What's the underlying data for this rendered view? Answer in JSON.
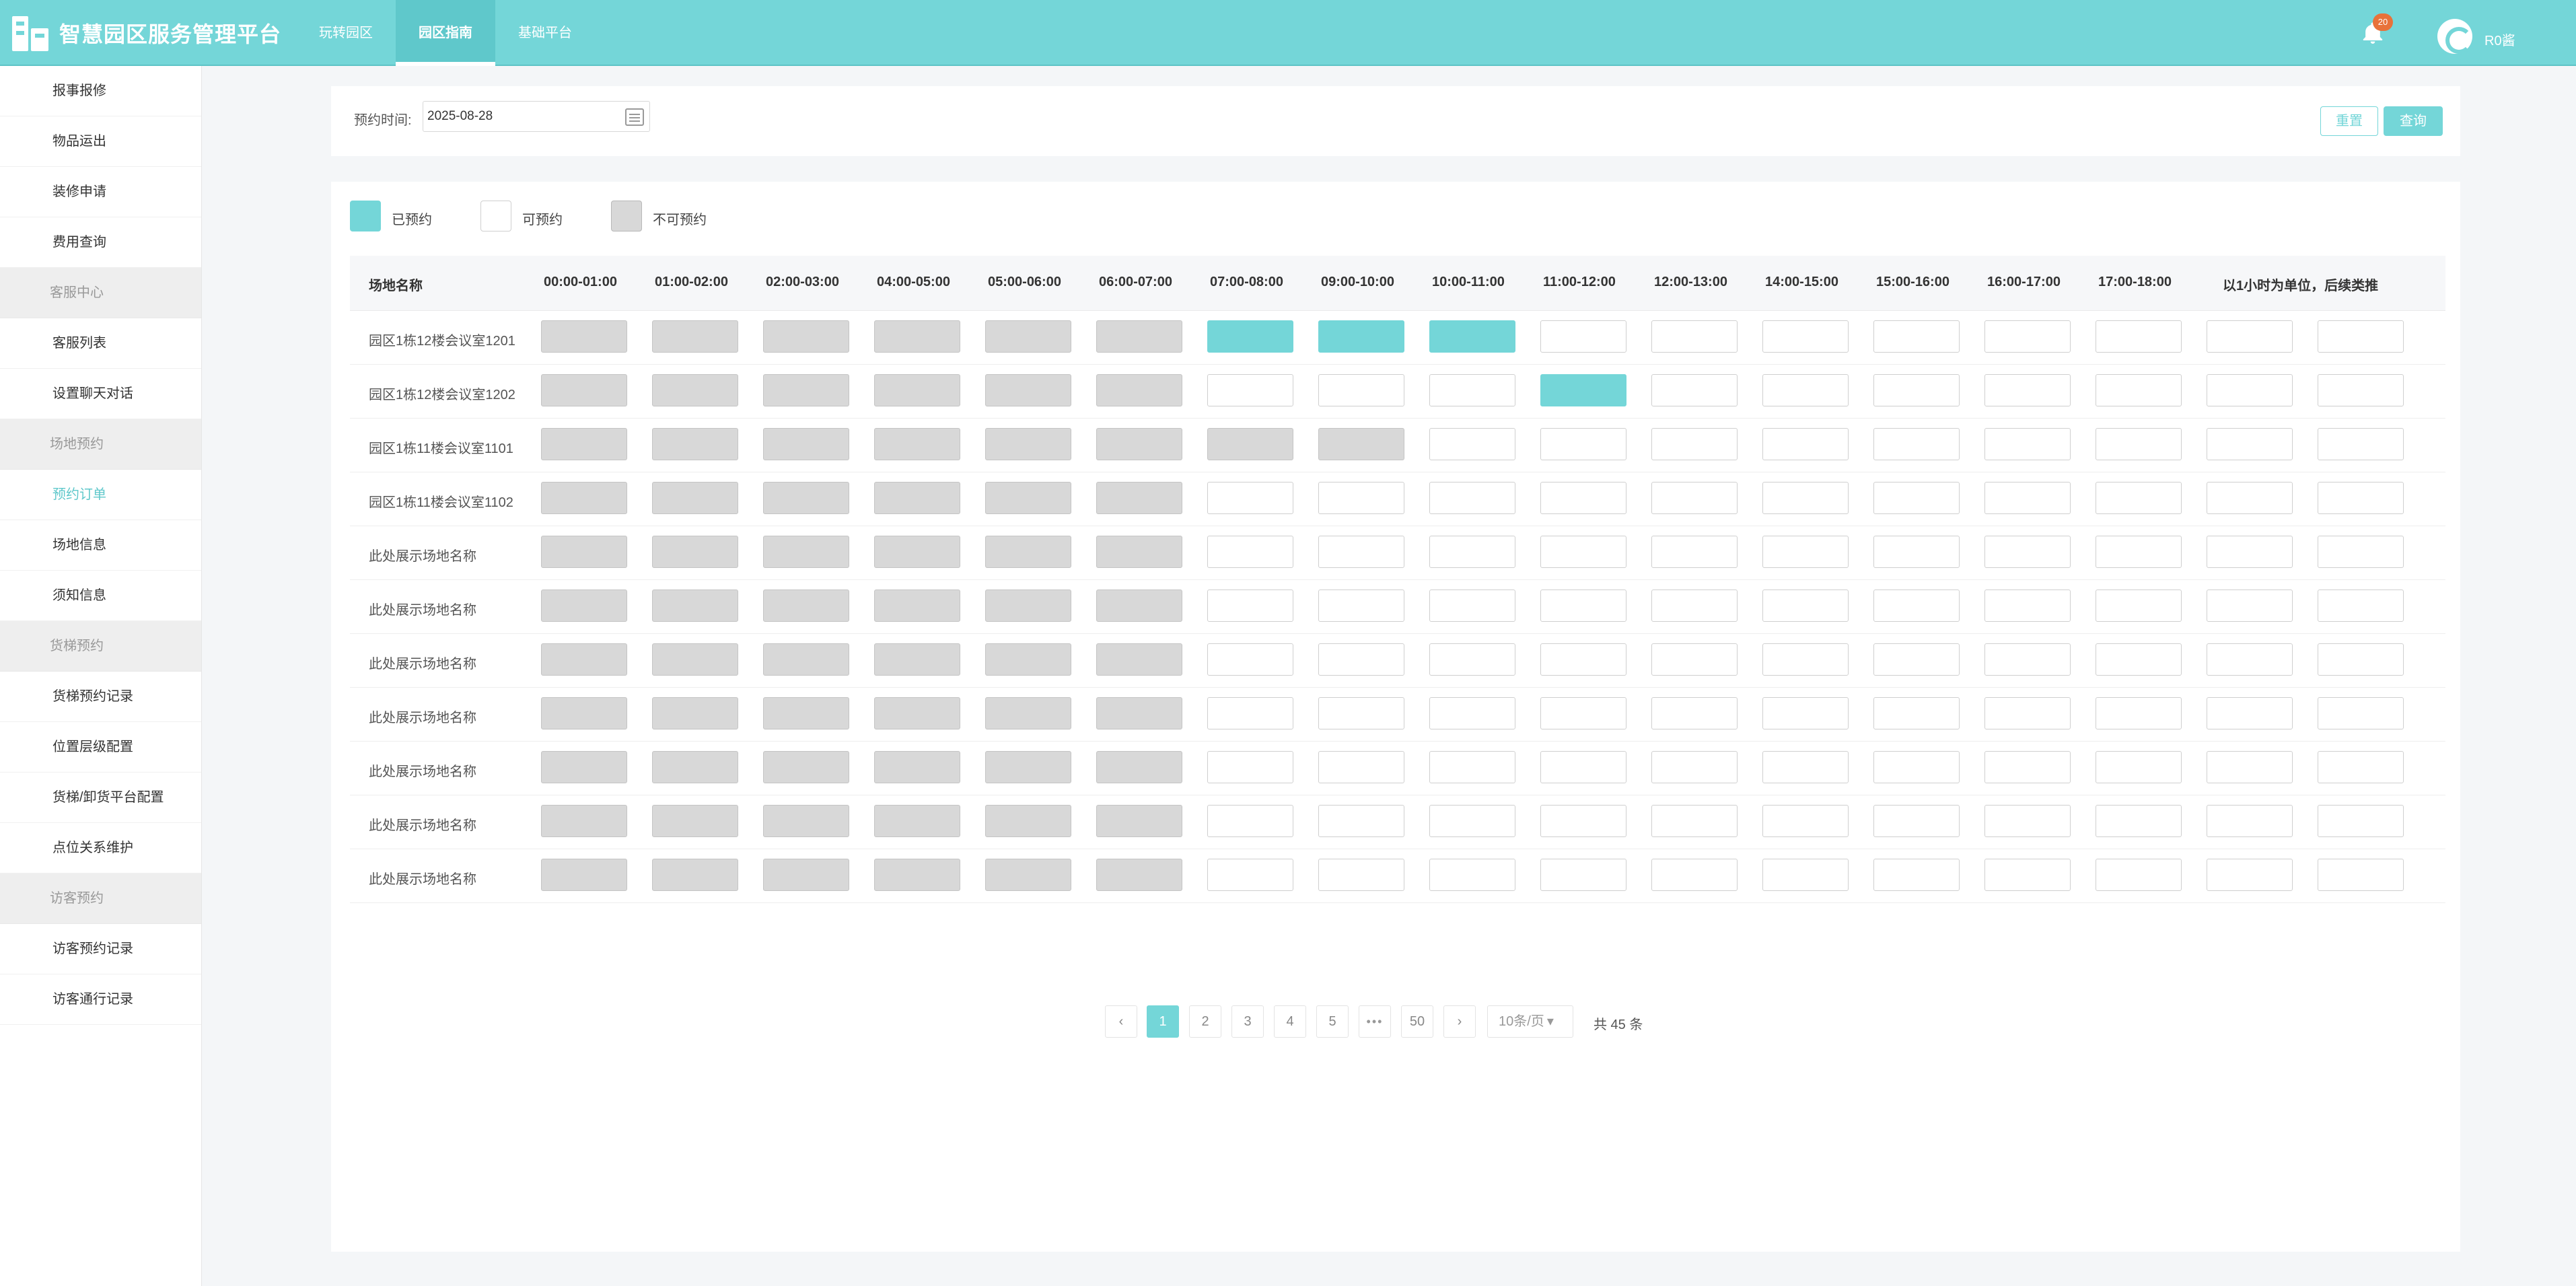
{
  "header": {
    "app_title": "智慧园区服务管理平台",
    "tabs": [
      {
        "label": "玩转园区",
        "active": false
      },
      {
        "label": "园区指南",
        "active": true
      },
      {
        "label": "基础平台",
        "active": false
      }
    ],
    "notification_count": "20",
    "username": "R0酱",
    "icons": {
      "logo": "building-logo-icon",
      "bell": "bell-icon",
      "avatar": "user-avatar-icon"
    }
  },
  "sidebar": {
    "items": [
      {
        "type": "item",
        "label": "报事报修"
      },
      {
        "type": "item",
        "label": "物品运出"
      },
      {
        "type": "item",
        "label": "装修申请"
      },
      {
        "type": "item",
        "label": "费用查询"
      },
      {
        "type": "group",
        "label": "客服中心"
      },
      {
        "type": "item",
        "label": "客服列表"
      },
      {
        "type": "item",
        "label": "设置聊天对话"
      },
      {
        "type": "group",
        "label": "场地预约"
      },
      {
        "type": "item",
        "label": "预约订单",
        "active": true
      },
      {
        "type": "item",
        "label": "场地信息"
      },
      {
        "type": "item",
        "label": "须知信息"
      },
      {
        "type": "group",
        "label": "货梯预约"
      },
      {
        "type": "item",
        "label": "货梯预约记录"
      },
      {
        "type": "item",
        "label": "位置层级配置"
      },
      {
        "type": "item",
        "label": "货梯/卸货平台配置"
      },
      {
        "type": "item",
        "label": "点位关系维护"
      },
      {
        "type": "group",
        "label": "访客预约"
      },
      {
        "type": "item",
        "label": "访客预约记录"
      },
      {
        "type": "item",
        "label": "访客通行记录"
      }
    ]
  },
  "filter": {
    "date_label": "预约时间:",
    "date_value": "2025-08-28",
    "reset_label": "重置",
    "query_label": "查询"
  },
  "legend": [
    {
      "label": "已预约",
      "state": "booked"
    },
    {
      "label": "可预约",
      "state": "available"
    },
    {
      "label": "不可预约",
      "state": "unavailable"
    }
  ],
  "grid": {
    "name_header": "场地名称",
    "slot_headers": [
      "00:00-01:00",
      "01:00-02:00",
      "02:00-03:00",
      "04:00-05:00",
      "05:00-06:00",
      "06:00-07:00",
      "07:00-08:00",
      "09:00-10:00",
      "10:00-11:00",
      "11:00-12:00",
      "12:00-13:00",
      "14:00-15:00",
      "15:00-16:00",
      "16:00-17:00",
      "17:00-18:00",
      "以1小时为单位，后续类推",
      ""
    ],
    "rows": [
      {
        "name": "园区1栋12楼会议室1201",
        "cells": [
          "U",
          "U",
          "U",
          "U",
          "U",
          "U",
          "B",
          "B",
          "B",
          "A",
          "A",
          "A",
          "A",
          "A",
          "A",
          "A",
          "A"
        ]
      },
      {
        "name": "园区1栋12楼会议室1202",
        "cells": [
          "U",
          "U",
          "U",
          "U",
          "U",
          "U",
          "A",
          "A",
          "A",
          "B",
          "A",
          "A",
          "A",
          "A",
          "A",
          "A",
          "A"
        ]
      },
      {
        "name": "园区1栋11楼会议室1101",
        "cells": [
          "U",
          "U",
          "U",
          "U",
          "U",
          "U",
          "U",
          "U",
          "A",
          "A",
          "A",
          "A",
          "A",
          "A",
          "A",
          "A",
          "A"
        ]
      },
      {
        "name": "园区1栋11楼会议室1102",
        "cells": [
          "U",
          "U",
          "U",
          "U",
          "U",
          "U",
          "A",
          "A",
          "A",
          "A",
          "A",
          "A",
          "A",
          "A",
          "A",
          "A",
          "A"
        ]
      },
      {
        "name": "此处展示场地名称",
        "cells": [
          "U",
          "U",
          "U",
          "U",
          "U",
          "U",
          "A",
          "A",
          "A",
          "A",
          "A",
          "A",
          "A",
          "A",
          "A",
          "A",
          "A"
        ]
      },
      {
        "name": "此处展示场地名称",
        "cells": [
          "U",
          "U",
          "U",
          "U",
          "U",
          "U",
          "A",
          "A",
          "A",
          "A",
          "A",
          "A",
          "A",
          "A",
          "A",
          "A",
          "A"
        ]
      },
      {
        "name": "此处展示场地名称",
        "cells": [
          "U",
          "U",
          "U",
          "U",
          "U",
          "U",
          "A",
          "A",
          "A",
          "A",
          "A",
          "A",
          "A",
          "A",
          "A",
          "A",
          "A"
        ]
      },
      {
        "name": "此处展示场地名称",
        "cells": [
          "U",
          "U",
          "U",
          "U",
          "U",
          "U",
          "A",
          "A",
          "A",
          "A",
          "A",
          "A",
          "A",
          "A",
          "A",
          "A",
          "A"
        ]
      },
      {
        "name": "此处展示场地名称",
        "cells": [
          "U",
          "U",
          "U",
          "U",
          "U",
          "U",
          "A",
          "A",
          "A",
          "A",
          "A",
          "A",
          "A",
          "A",
          "A",
          "A",
          "A"
        ]
      },
      {
        "name": "此处展示场地名称",
        "cells": [
          "U",
          "U",
          "U",
          "U",
          "U",
          "U",
          "A",
          "A",
          "A",
          "A",
          "A",
          "A",
          "A",
          "A",
          "A",
          "A",
          "A"
        ]
      },
      {
        "name": "此处展示场地名称",
        "cells": [
          "U",
          "U",
          "U",
          "U",
          "U",
          "U",
          "A",
          "A",
          "A",
          "A",
          "A",
          "A",
          "A",
          "A",
          "A",
          "A",
          "A"
        ]
      }
    ]
  },
  "pagination": {
    "prev": "‹",
    "pages": [
      "1",
      "2",
      "3",
      "4",
      "5"
    ],
    "current": "1",
    "ellipsis": "•••",
    "last": "50",
    "next": "›",
    "page_size": "10条/页",
    "page_size_caret": "▾",
    "total": "共 45 条"
  },
  "colors": {
    "accent": "#74d6d8",
    "booked": "#74d6d8",
    "available": "#ffffff",
    "unavailable": "#d8d8d8"
  }
}
